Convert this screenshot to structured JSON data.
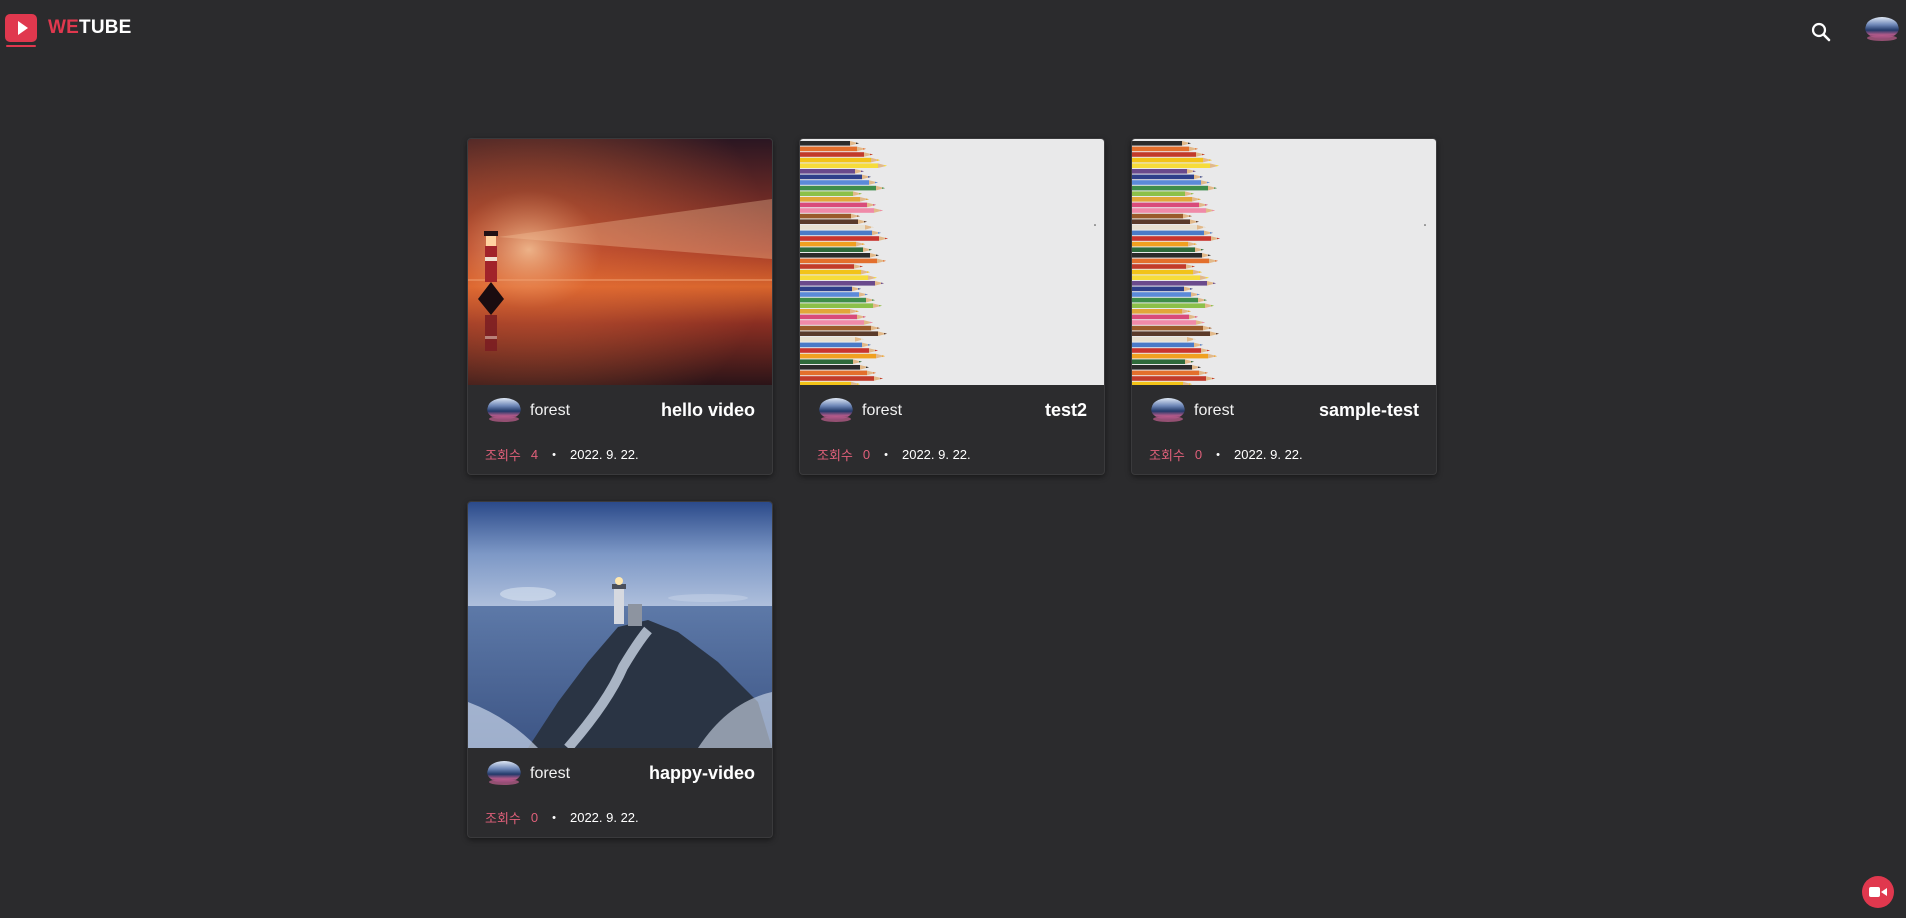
{
  "brand": {
    "prefix": "WE",
    "suffix": "TUBE",
    "accent_color": "#e0384e"
  },
  "header": {
    "search_icon": "search-icon",
    "avatar_icon": "user-avatar"
  },
  "videos": [
    {
      "title": "hello video",
      "owner": "forest",
      "views_label": "조회수",
      "views": "4",
      "separator": "•",
      "date": "2022. 9. 22.",
      "thumbnail": "lighthouse-sunset"
    },
    {
      "title": "test2",
      "owner": "forest",
      "views_label": "조회수",
      "views": "0",
      "separator": "•",
      "date": "2022. 9. 22.",
      "thumbnail": "colored-pencils"
    },
    {
      "title": "sample-test",
      "owner": "forest",
      "views_label": "조회수",
      "views": "0",
      "separator": "•",
      "date": "2022. 9. 22.",
      "thumbnail": "colored-pencils"
    },
    {
      "title": "happy-video",
      "owner": "forest",
      "views_label": "조회수",
      "views": "0",
      "separator": "•",
      "date": "2022. 9. 22.",
      "thumbnail": "lighthouse-coast"
    }
  ],
  "fab": {
    "icon": "video-camera-icon"
  }
}
